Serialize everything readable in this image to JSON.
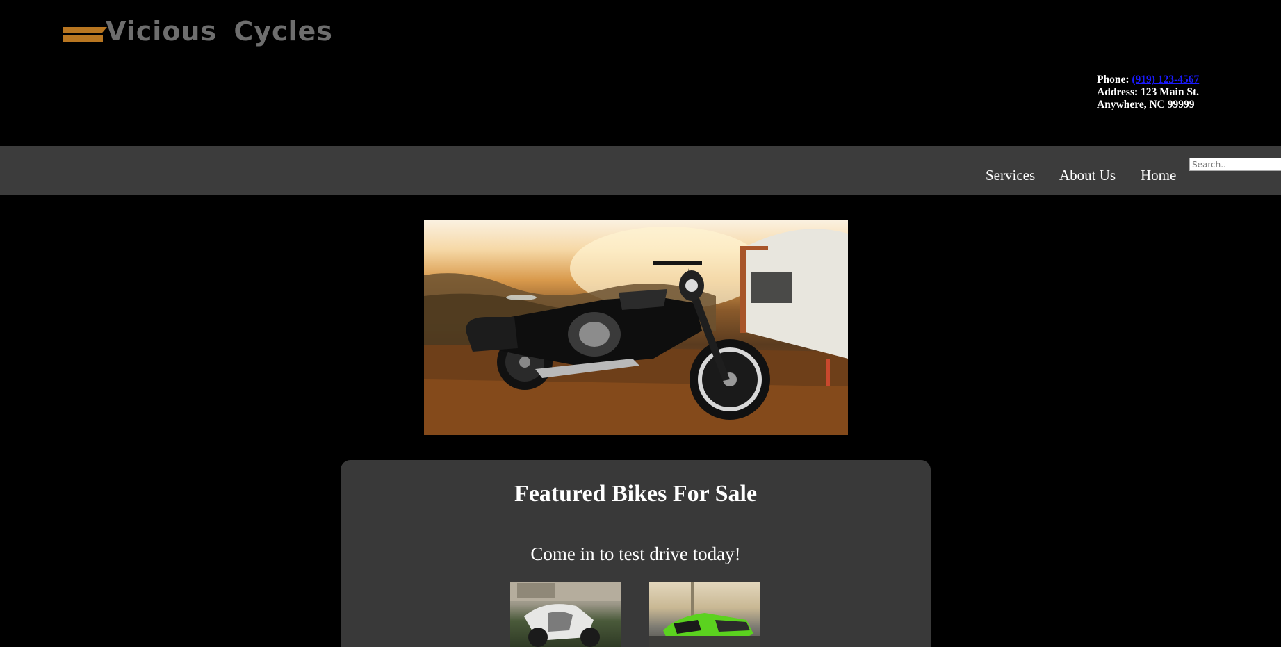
{
  "header": {
    "logo_text": "Vicious Cycles",
    "contact": {
      "phone_label": "Phone:",
      "phone_value": "(919) 123-4567",
      "address_label": "Address:",
      "address_line1": "123 Main St.",
      "address_line2": "Anywhere, NC 99999"
    }
  },
  "nav": {
    "items": [
      {
        "label": "Services"
      },
      {
        "label": "About Us"
      },
      {
        "label": "Home"
      }
    ],
    "search_placeholder": "Search.."
  },
  "hero": {
    "image": "motorcycle-at-sunset"
  },
  "featured": {
    "title": "Featured Bikes For Sale",
    "subtitle": "Come in to test drive today!",
    "thumbnails": [
      {
        "image": "white-sport-bike"
      },
      {
        "image": "green-sport-bike"
      }
    ]
  },
  "colors": {
    "background": "#000000",
    "nav_bar": "#3c3c3c",
    "panel": "#393939",
    "logo_accent": "#b87621",
    "logo_text": "#6e6e6e",
    "link": "#1a1aff"
  }
}
